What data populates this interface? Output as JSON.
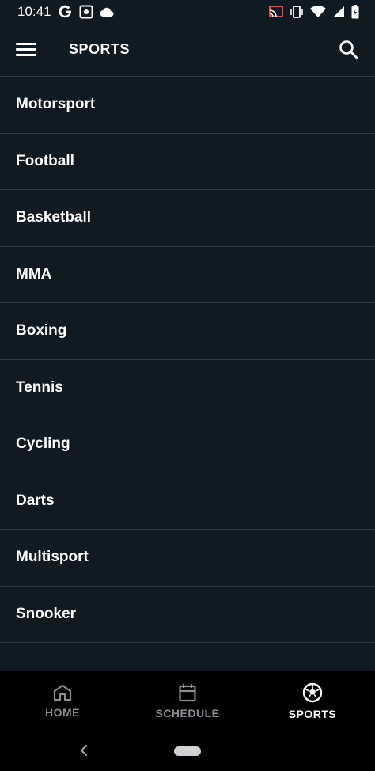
{
  "status_bar": {
    "time": "10:41",
    "left_icons": [
      "google-icon",
      "photo-icon",
      "cloud-icon"
    ],
    "right_icons": [
      "cast-icon",
      "vibrate-icon",
      "wifi-icon",
      "signal-icon",
      "battery-icon"
    ]
  },
  "app_bar": {
    "title": "SPORTS",
    "menu_icon": "menu-icon",
    "search_icon": "search-icon"
  },
  "sports": [
    {
      "label": "Motorsport"
    },
    {
      "label": "Football"
    },
    {
      "label": "Basketball"
    },
    {
      "label": "MMA"
    },
    {
      "label": "Boxing"
    },
    {
      "label": "Tennis"
    },
    {
      "label": "Cycling"
    },
    {
      "label": "Darts"
    },
    {
      "label": "Multisport"
    },
    {
      "label": "Snooker"
    }
  ],
  "bottom_nav": {
    "items": [
      {
        "label": "HOME",
        "icon": "home-icon",
        "active": false
      },
      {
        "label": "SCHEDULE",
        "icon": "calendar-icon",
        "active": false
      },
      {
        "label": "SPORTS",
        "icon": "soccer-ball-icon",
        "active": true
      }
    ]
  },
  "colors": {
    "background": "#0f1a22",
    "divider": "#2e3a43",
    "nav_background": "#000000",
    "inactive": "#8a8f94",
    "active": "#ffffff"
  }
}
